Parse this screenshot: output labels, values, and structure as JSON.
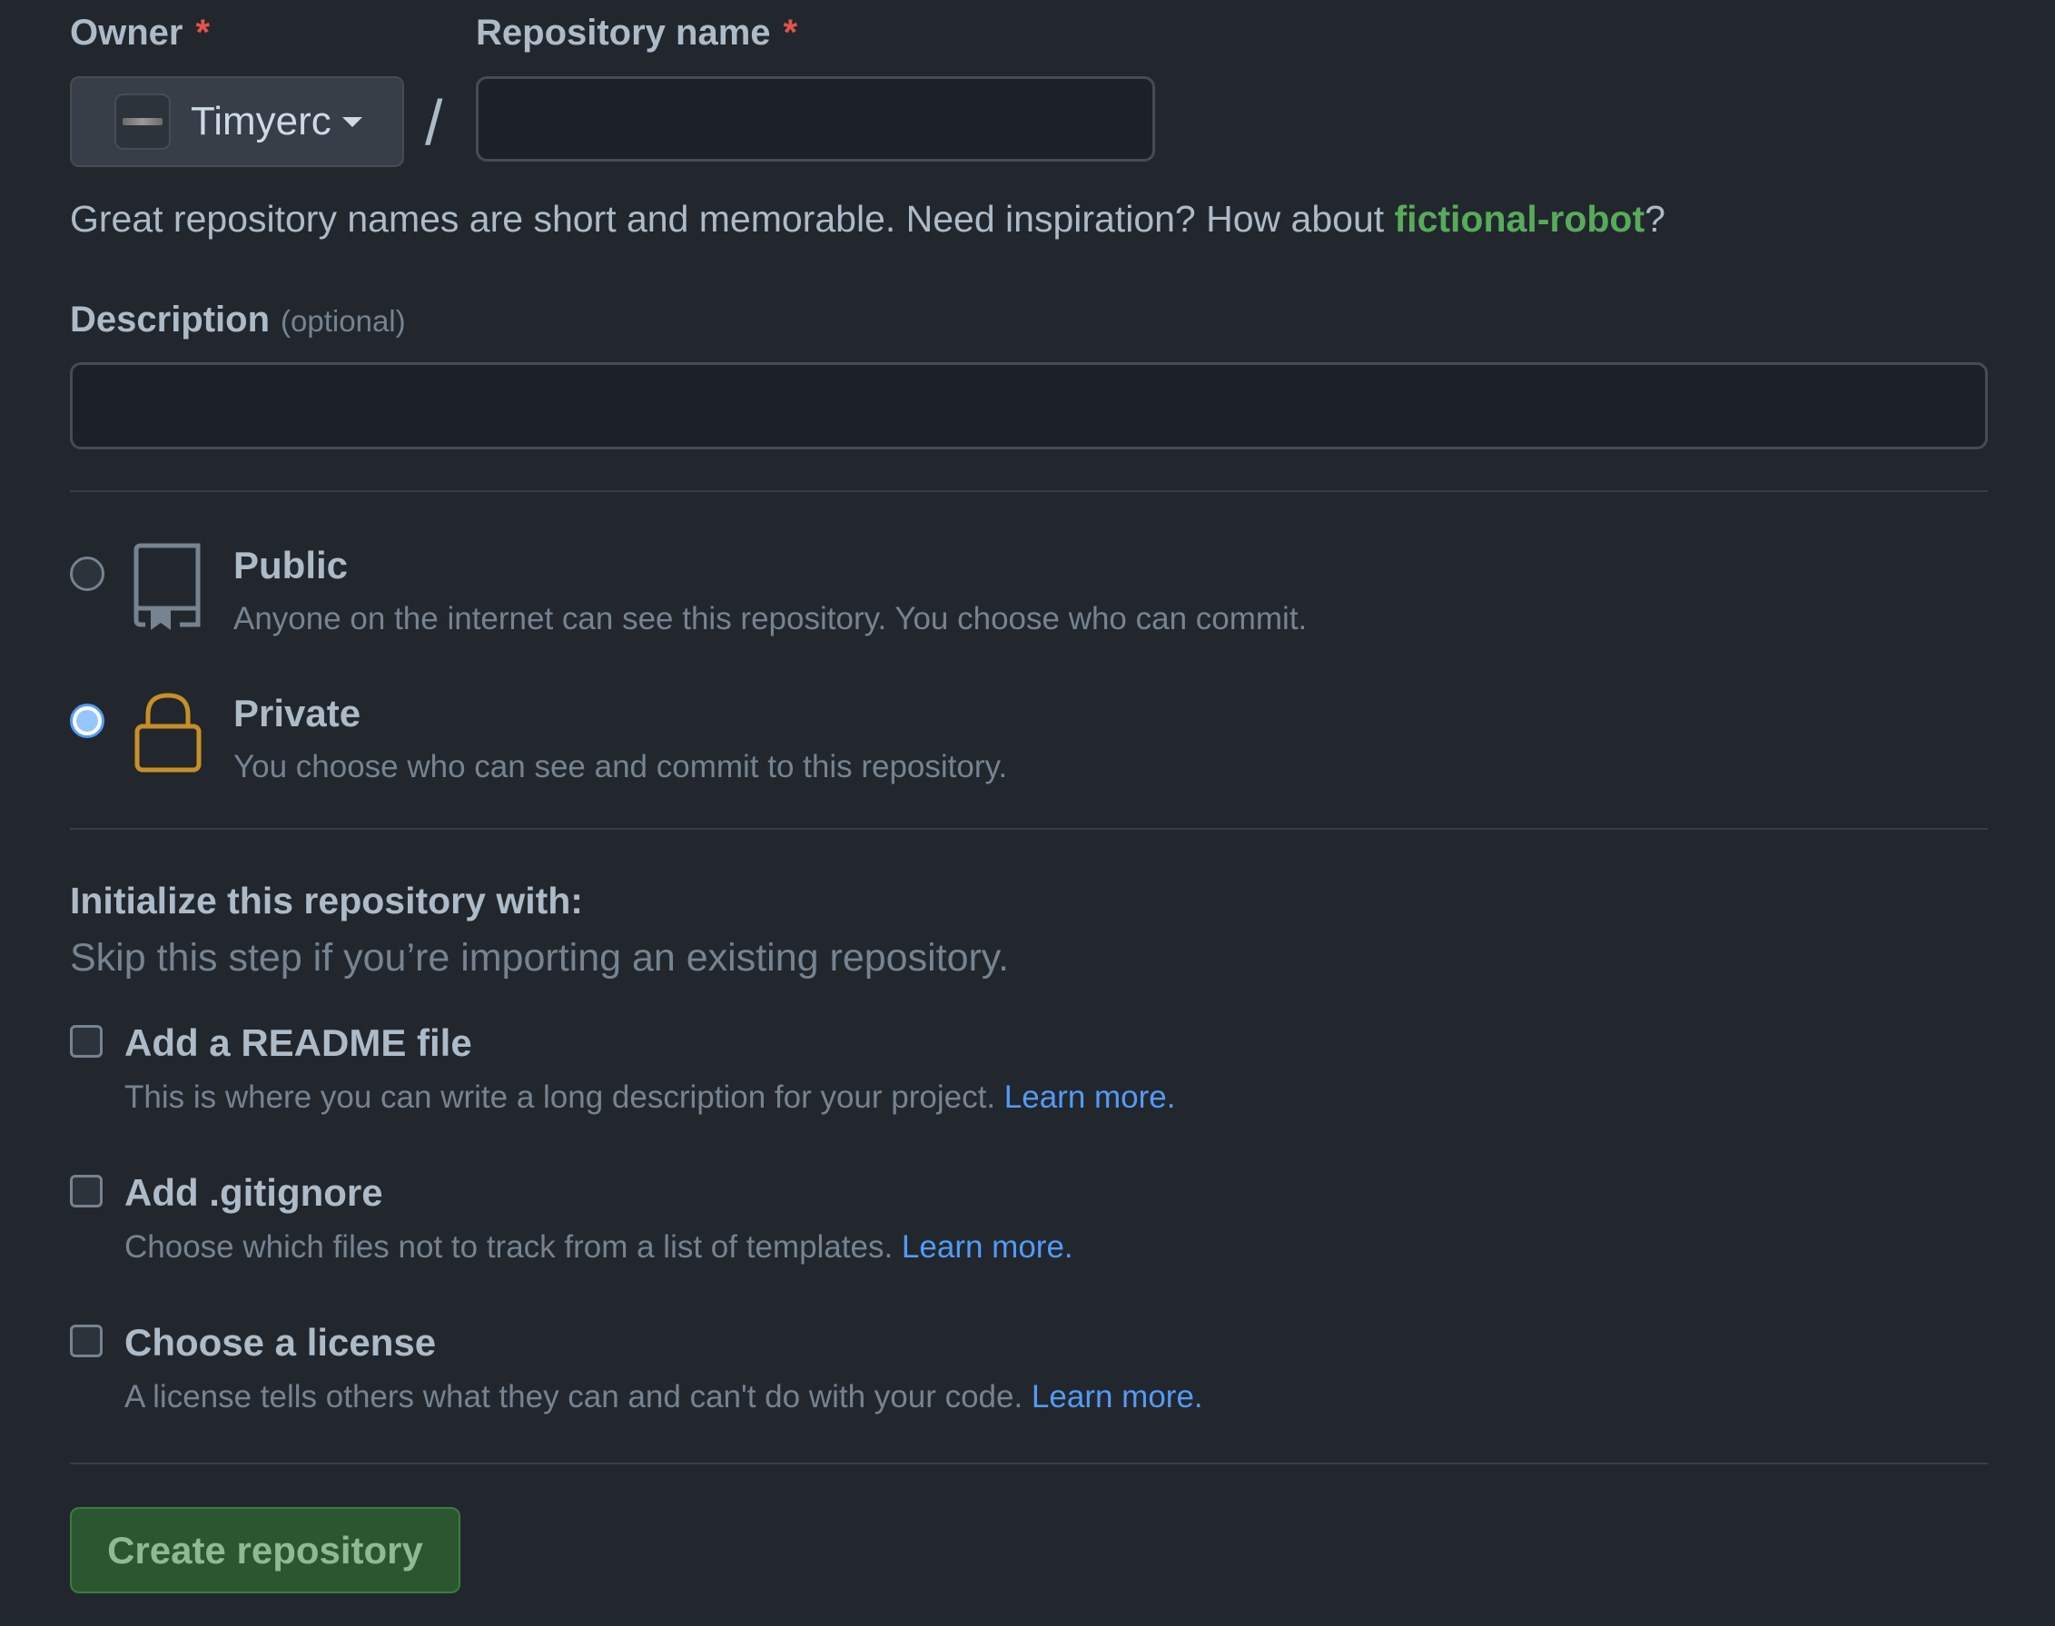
{
  "owner": {
    "label": "Owner",
    "required_mark": "*",
    "selected": "Timyerc"
  },
  "repo_name": {
    "label": "Repository name",
    "required_mark": "*",
    "value": "",
    "placeholder": ""
  },
  "separator": "/",
  "hint": {
    "text": "Great repository names are short and memorable. Need inspiration? How about ",
    "suggestion": "fictional-robot",
    "suffix": "?"
  },
  "description": {
    "label": "Description",
    "optional": "(optional)",
    "value": "",
    "placeholder": ""
  },
  "visibility": {
    "selected": "private",
    "options": [
      {
        "id": "public",
        "title": "Public",
        "description": "Anyone on the internet can see this repository. You choose who can commit.",
        "icon": "repo-icon"
      },
      {
        "id": "private",
        "title": "Private",
        "description": "You choose who can see and commit to this repository.",
        "icon": "lock-icon"
      }
    ]
  },
  "initialize": {
    "title": "Initialize this repository with:",
    "subtitle": "Skip this step if you’re importing an existing repository.",
    "options": [
      {
        "title": "Add a README file",
        "description": "This is where you can write a long description for your project. ",
        "link": "Learn more.",
        "checked": false
      },
      {
        "title": "Add .gitignore",
        "description": "Choose which files not to track from a list of templates. ",
        "link": "Learn more.",
        "checked": false
      },
      {
        "title": "Choose a license",
        "description": "A license tells others what they can and can't do with your code. ",
        "link": "Learn more.",
        "checked": false
      }
    ]
  },
  "submit": {
    "label": "Create repository"
  },
  "colors": {
    "background": "#22272e",
    "accent_green": "#57ab5a",
    "link_blue": "#539bf5",
    "required_red": "#e5534b",
    "lock_yellow": "#c69026"
  }
}
